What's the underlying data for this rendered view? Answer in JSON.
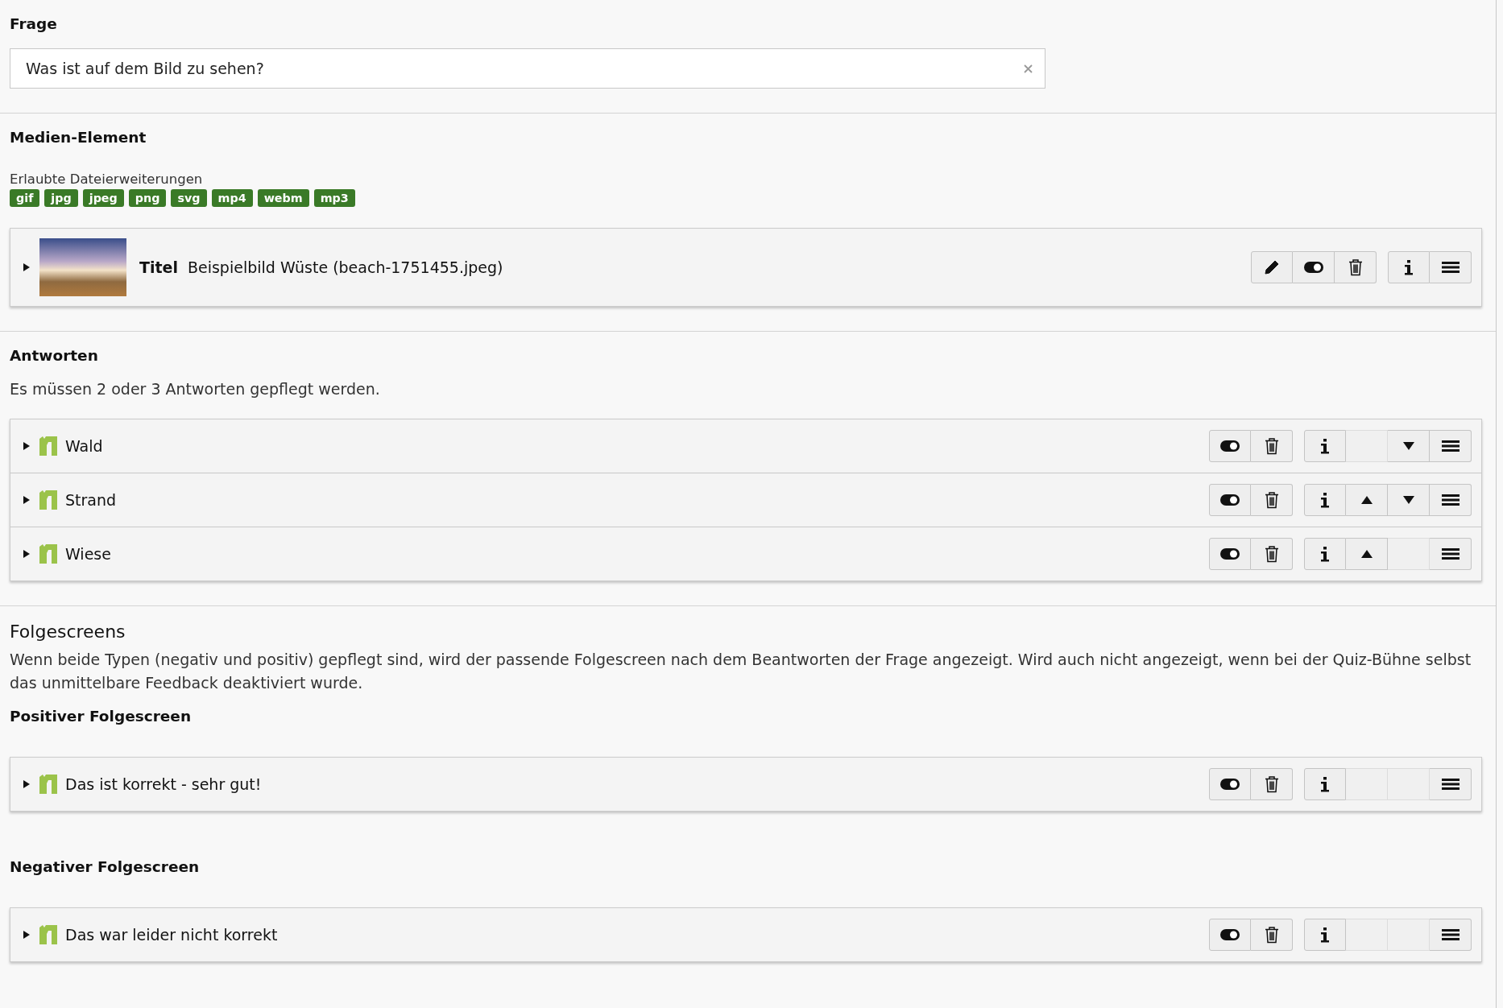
{
  "question": {
    "heading": "Frage",
    "value": "Was ist auf dem Bild zu sehen?"
  },
  "media": {
    "heading": "Medien-Element",
    "extensions_label": "Erlaubte Dateierweiterungen",
    "extensions": [
      "gif",
      "jpg",
      "jpeg",
      "png",
      "svg",
      "mp4",
      "webm",
      "mp3"
    ],
    "records": [
      {
        "kind": "media",
        "expanded": false,
        "label": "Titel",
        "title": "Beispielbild Wüste (beach-1751455.jpeg)",
        "actions": [
          [
            {
              "kind": "edit",
              "disabled": false
            },
            {
              "kind": "toggle",
              "disabled": false
            },
            {
              "kind": "delete",
              "disabled": false
            }
          ],
          [
            {
              "kind": "info",
              "disabled": false
            },
            {
              "kind": "menu",
              "disabled": false
            }
          ]
        ]
      }
    ]
  },
  "answers": {
    "heading": "Antworten",
    "note": "Es müssen 2 oder 3 Antworten gepflegt werden.",
    "records": [
      {
        "kind": "content",
        "expanded": false,
        "title": "Wald",
        "actions": [
          [
            {
              "kind": "toggle",
              "disabled": false
            },
            {
              "kind": "delete",
              "disabled": false
            }
          ],
          [
            {
              "kind": "info",
              "disabled": false
            },
            {
              "kind": "up",
              "disabled": true
            },
            {
              "kind": "down",
              "disabled": false
            },
            {
              "kind": "menu",
              "disabled": false
            }
          ]
        ]
      },
      {
        "kind": "content",
        "expanded": false,
        "title": "Strand",
        "actions": [
          [
            {
              "kind": "toggle",
              "disabled": false
            },
            {
              "kind": "delete",
              "disabled": false
            }
          ],
          [
            {
              "kind": "info",
              "disabled": false
            },
            {
              "kind": "up",
              "disabled": false
            },
            {
              "kind": "down",
              "disabled": false
            },
            {
              "kind": "menu",
              "disabled": false
            }
          ]
        ]
      },
      {
        "kind": "content",
        "expanded": false,
        "title": "Wiese",
        "actions": [
          [
            {
              "kind": "toggle",
              "disabled": false
            },
            {
              "kind": "delete",
              "disabled": false
            }
          ],
          [
            {
              "kind": "info",
              "disabled": false
            },
            {
              "kind": "up",
              "disabled": false
            },
            {
              "kind": "down",
              "disabled": true
            },
            {
              "kind": "menu",
              "disabled": false
            }
          ]
        ]
      }
    ]
  },
  "followups": {
    "heading": "Folgescreens",
    "description": "Wenn beide Typen (negativ und positiv) gepflegt sind, wird der passende Folgescreen nach dem Beantworten der Frage angezeigt. Wird auch nicht angezeigt, wenn bei der Quiz-Bühne selbst das unmittelbare Feedback deaktiviert wurde.",
    "groups": [
      {
        "heading": "Positiver Folgescreen",
        "records": [
          {
            "kind": "content",
            "expanded": false,
            "title": "Das ist korrekt - sehr gut!",
            "actions": [
              [
                {
                  "kind": "toggle",
                  "disabled": false
                },
                {
                  "kind": "delete",
                  "disabled": false
                }
              ],
              [
                {
                  "kind": "info",
                  "disabled": false
                },
                {
                  "kind": "up",
                  "disabled": true
                },
                {
                  "kind": "down",
                  "disabled": true
                },
                {
                  "kind": "menu",
                  "disabled": false
                }
              ]
            ]
          }
        ]
      },
      {
        "heading": "Negativer Folgescreen",
        "records": [
          {
            "kind": "content",
            "expanded": false,
            "title": "Das war leider nicht korrekt",
            "actions": [
              [
                {
                  "kind": "toggle",
                  "disabled": false
                },
                {
                  "kind": "delete",
                  "disabled": false
                }
              ],
              [
                {
                  "kind": "info",
                  "disabled": false
                },
                {
                  "kind": "up",
                  "disabled": true
                },
                {
                  "kind": "down",
                  "disabled": true
                },
                {
                  "kind": "menu",
                  "disabled": false
                }
              ]
            ]
          }
        ]
      }
    ]
  }
}
